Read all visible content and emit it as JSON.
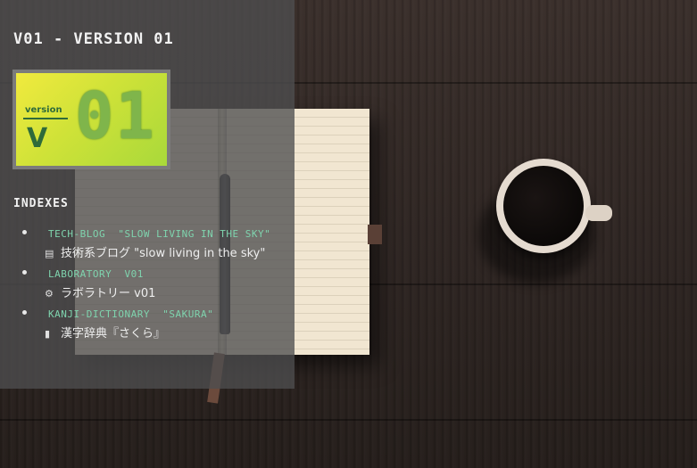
{
  "page": {
    "title": "V01 - VERSION 01"
  },
  "logo": {
    "version_word": "version",
    "v_letter": "V",
    "number": "01",
    "colors": {
      "bg_start": "#f1ea3e",
      "bg_end": "#a9d93a",
      "frame": "#7b7b7b",
      "digits": "#7fb54b"
    }
  },
  "indexes": {
    "heading": "INDEXES",
    "items": [
      {
        "link": "TECH-BLOG  \"SLOW LIVING IN THE SKY\"",
        "icon": "newspaper-icon",
        "icon_glyph": "▤",
        "desc": "技術系ブログ \"slow living in the sky\""
      },
      {
        "link": "LABORATORY  V01",
        "icon": "gears-icon",
        "icon_glyph": "⚙",
        "desc": "ラボラトリー v01"
      },
      {
        "link": "KANJI-DICTIONARY  \"SAKURA\"",
        "icon": "book-icon",
        "icon_glyph": "▮",
        "desc": "漢字辞典『さくら』"
      }
    ]
  },
  "colors": {
    "panel": "#4e4e50",
    "link": "#7fd4ae",
    "text": "#eeeeee"
  }
}
